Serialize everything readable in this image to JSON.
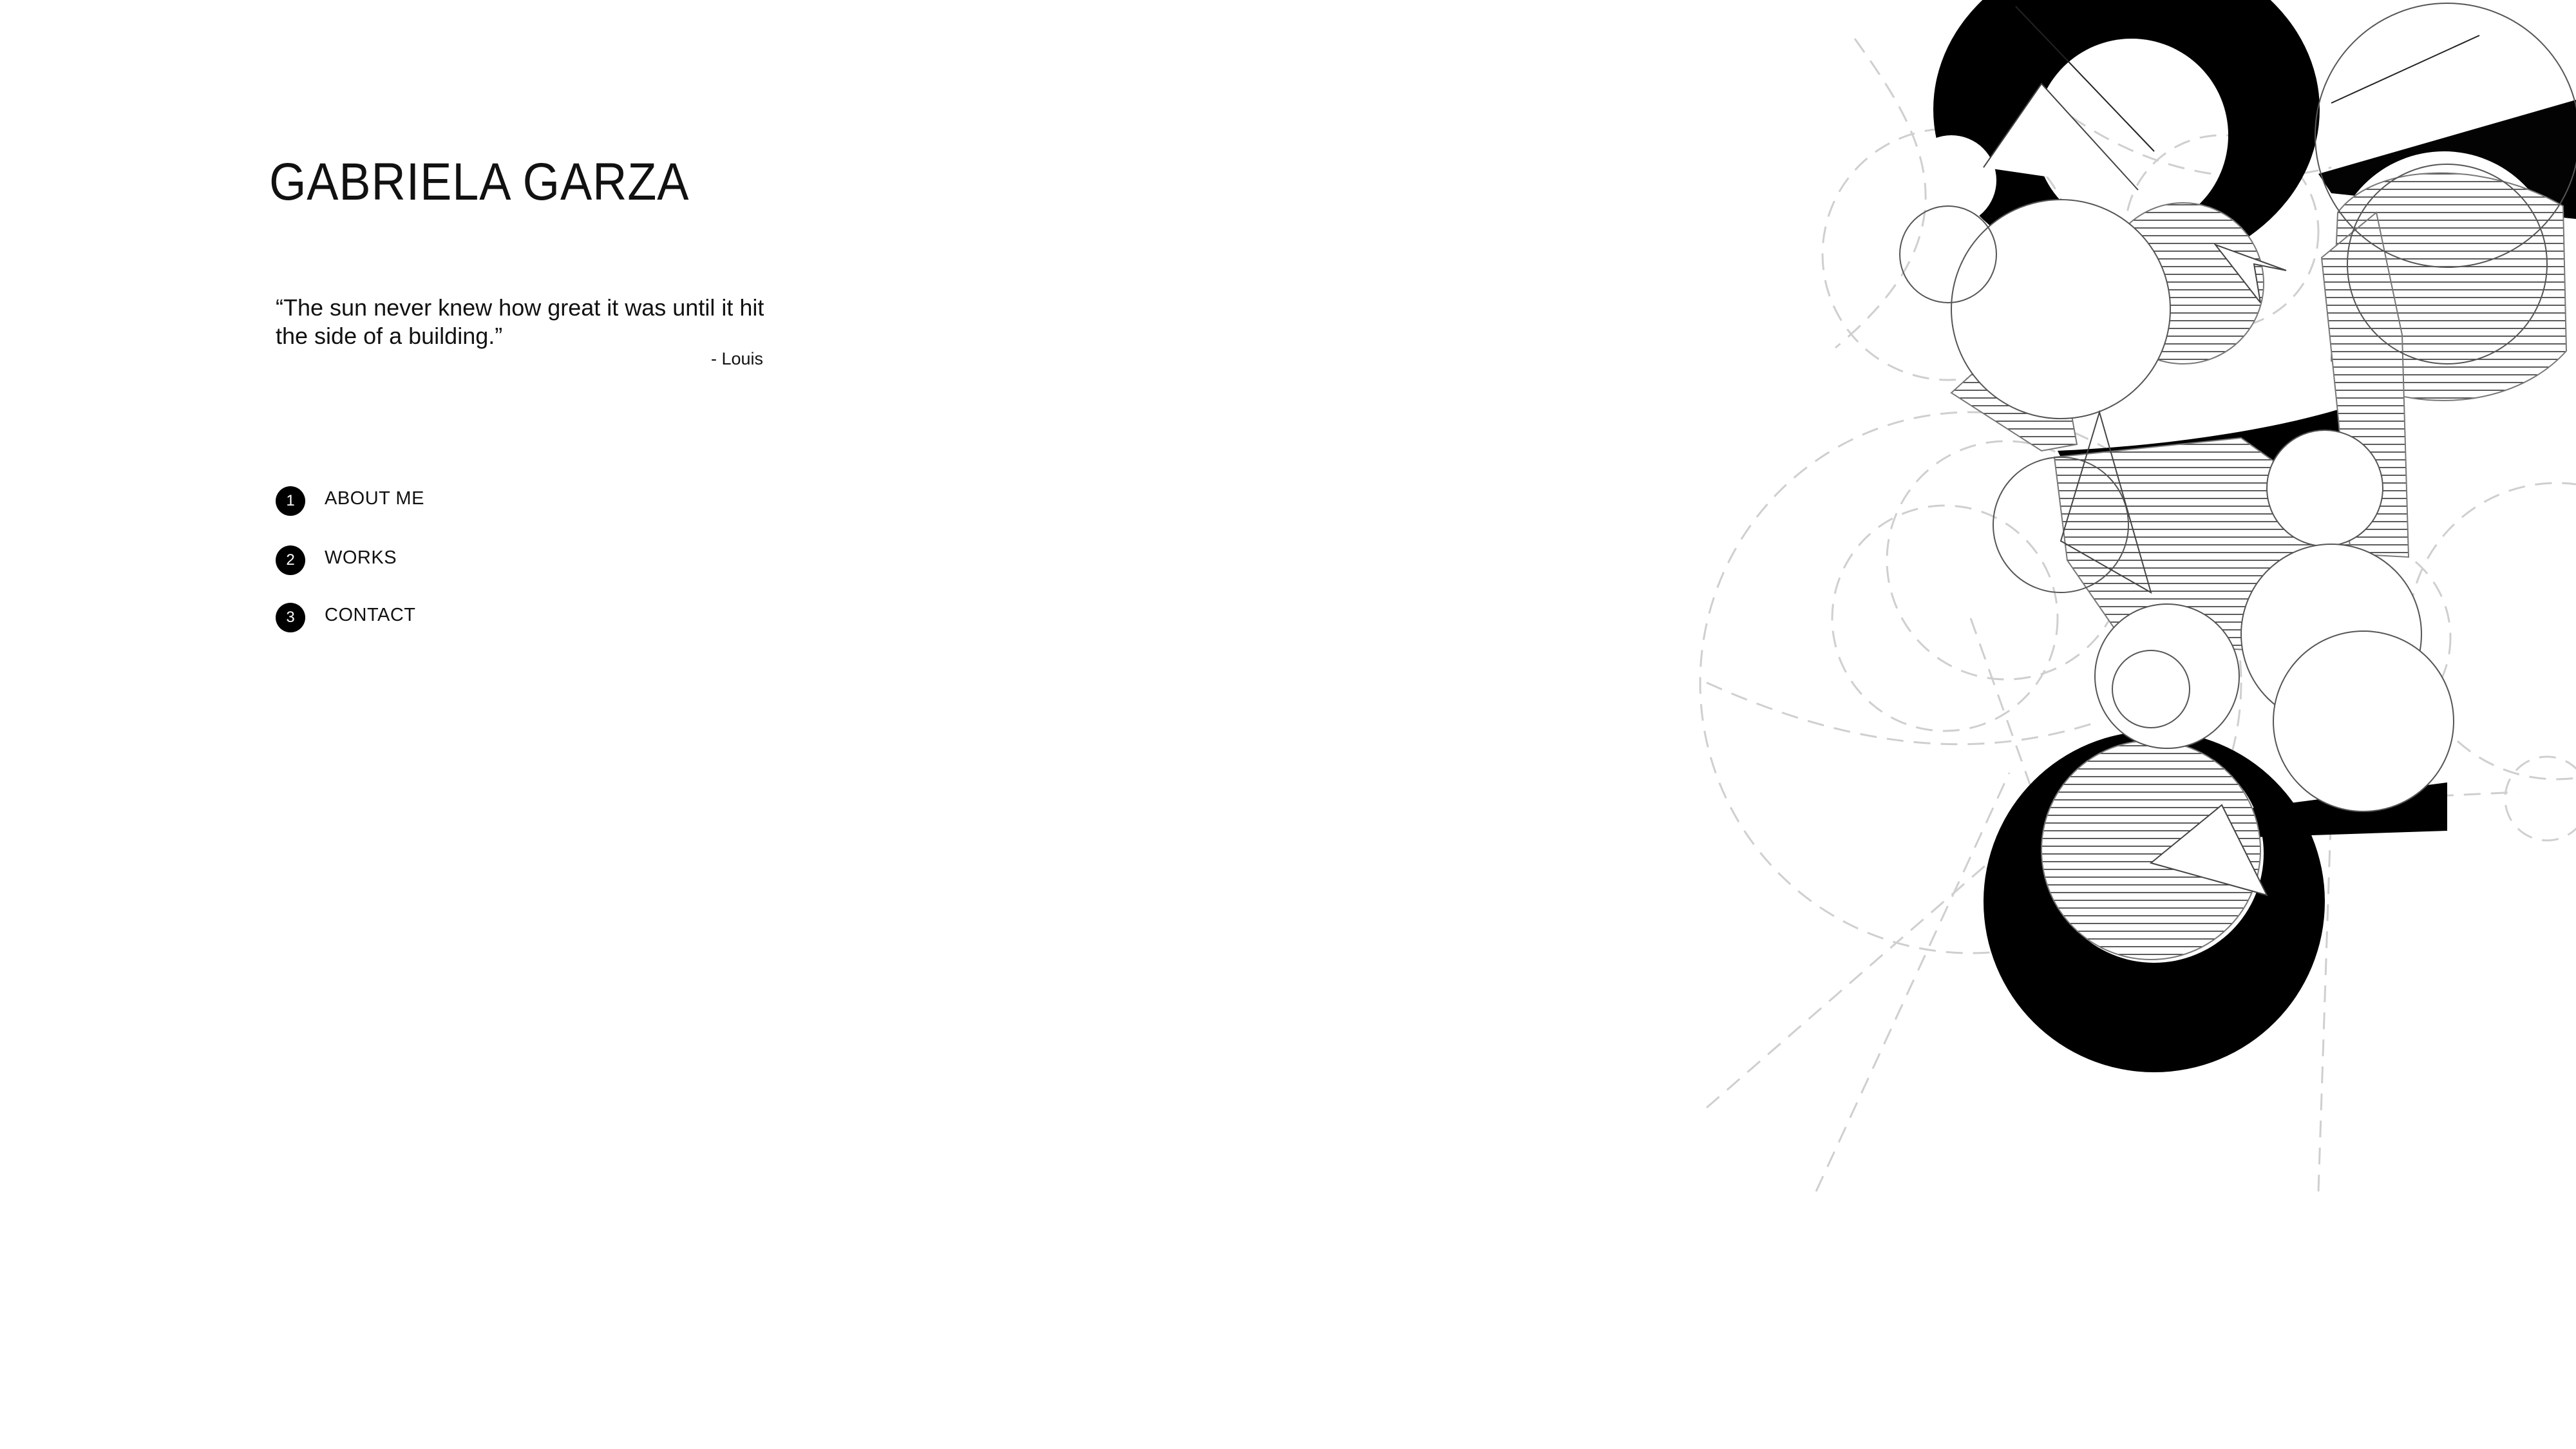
{
  "header": {
    "title": "GABRIELA GARZA"
  },
  "quote": {
    "text": "“The sun never knew how great it was until it hit the side of a building.”",
    "author": "- Louis"
  },
  "nav": {
    "items": [
      {
        "number": "1",
        "label": "ABOUT ME"
      },
      {
        "number": "2",
        "label": "WORKS"
      },
      {
        "number": "3",
        "label": "CONTACT"
      }
    ]
  },
  "colors": {
    "background": "#ffffff",
    "text": "#111111",
    "accent": "#000000"
  }
}
